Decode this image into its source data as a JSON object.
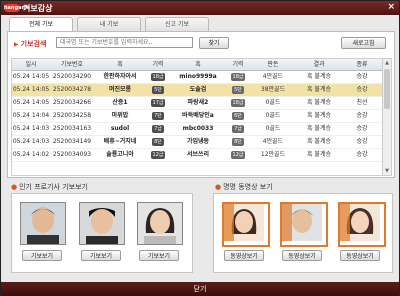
{
  "window": {
    "logo": "hangame",
    "title": "기보감상",
    "close_glyph": "×"
  },
  "tabs": [
    "전체 기보",
    "내 기보",
    "신고 기보"
  ],
  "search": {
    "label": "기보검색",
    "placeholder": "대국명 또는 기보번호를 입력하세요..",
    "find_label": "찾기",
    "refresh_label": "새로고침"
  },
  "table": {
    "headers": [
      "일시",
      "기보번호",
      "흑",
      "기력",
      "흑",
      "기력",
      "판돈",
      "결과",
      "종류"
    ],
    "rows": [
      [
        "05.24 14:05",
        "2520034290",
        "한판하자아서",
        "18급",
        "mino9999a",
        "18급",
        "4만골드",
        "흑 불계승",
        "승강"
      ],
      [
        "05.24 14:05",
        "2520034278",
        "며진모롱",
        "5단",
        "도솔검",
        "5단",
        "38만골드",
        "흑 불계승",
        "승강"
      ],
      [
        "05.24 14:05",
        "2520034266",
        "산증1",
        "17급",
        "파랑새2",
        "18급",
        "0골드",
        "흑 불계승",
        "친선"
      ],
      [
        "05.24 14:04",
        "2520034258",
        "마위밥",
        "7단",
        "바둑배당인a",
        "6단",
        "0골드",
        "흑 불계승",
        "승강"
      ],
      [
        "05.24 14:03",
        "2520034163",
        "sudol",
        "7급",
        "mbc0033",
        "7급",
        "0골드",
        "흑 불계승",
        "승강"
      ],
      [
        "05.24 14:03",
        "2520034149",
        "배휴~거지네",
        "8단",
        "가임냉동",
        "8단",
        "4만골드",
        "흑 불계승",
        "승강"
      ],
      [
        "05.24 14:02",
        "2520034093",
        "솔룡고니아",
        "12급",
        "서브쓰리",
        "12급",
        "12만골드",
        "흑 불계승",
        "승강"
      ]
    ],
    "selected_row": 1
  },
  "pro_section": {
    "title": "인기 프로기사 기보보기",
    "button_label": "기보보기",
    "count": 3
  },
  "video_section": {
    "title": "명명 동영상 보기",
    "button_label": "동영상보기",
    "count": 3
  },
  "footer": {
    "close_label": "닫기"
  },
  "colors": {
    "titlebar": "#5a1e1a",
    "selected_row": "#f2e2a6",
    "accent": "#d45a1a"
  }
}
